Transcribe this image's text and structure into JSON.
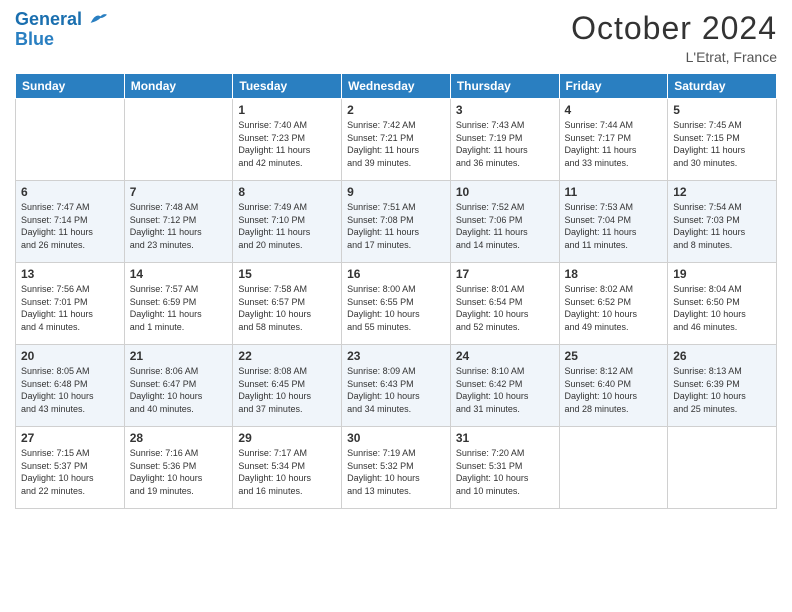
{
  "header": {
    "logo_line1": "General",
    "logo_line2": "Blue",
    "month": "October 2024",
    "location": "L'Etrat, France"
  },
  "weekdays": [
    "Sunday",
    "Monday",
    "Tuesday",
    "Wednesday",
    "Thursday",
    "Friday",
    "Saturday"
  ],
  "weeks": [
    [
      {
        "day": "",
        "info": ""
      },
      {
        "day": "",
        "info": ""
      },
      {
        "day": "1",
        "info": "Sunrise: 7:40 AM\nSunset: 7:23 PM\nDaylight: 11 hours\nand 42 minutes."
      },
      {
        "day": "2",
        "info": "Sunrise: 7:42 AM\nSunset: 7:21 PM\nDaylight: 11 hours\nand 39 minutes."
      },
      {
        "day": "3",
        "info": "Sunrise: 7:43 AM\nSunset: 7:19 PM\nDaylight: 11 hours\nand 36 minutes."
      },
      {
        "day": "4",
        "info": "Sunrise: 7:44 AM\nSunset: 7:17 PM\nDaylight: 11 hours\nand 33 minutes."
      },
      {
        "day": "5",
        "info": "Sunrise: 7:45 AM\nSunset: 7:15 PM\nDaylight: 11 hours\nand 30 minutes."
      }
    ],
    [
      {
        "day": "6",
        "info": "Sunrise: 7:47 AM\nSunset: 7:14 PM\nDaylight: 11 hours\nand 26 minutes."
      },
      {
        "day": "7",
        "info": "Sunrise: 7:48 AM\nSunset: 7:12 PM\nDaylight: 11 hours\nand 23 minutes."
      },
      {
        "day": "8",
        "info": "Sunrise: 7:49 AM\nSunset: 7:10 PM\nDaylight: 11 hours\nand 20 minutes."
      },
      {
        "day": "9",
        "info": "Sunrise: 7:51 AM\nSunset: 7:08 PM\nDaylight: 11 hours\nand 17 minutes."
      },
      {
        "day": "10",
        "info": "Sunrise: 7:52 AM\nSunset: 7:06 PM\nDaylight: 11 hours\nand 14 minutes."
      },
      {
        "day": "11",
        "info": "Sunrise: 7:53 AM\nSunset: 7:04 PM\nDaylight: 11 hours\nand 11 minutes."
      },
      {
        "day": "12",
        "info": "Sunrise: 7:54 AM\nSunset: 7:03 PM\nDaylight: 11 hours\nand 8 minutes."
      }
    ],
    [
      {
        "day": "13",
        "info": "Sunrise: 7:56 AM\nSunset: 7:01 PM\nDaylight: 11 hours\nand 4 minutes."
      },
      {
        "day": "14",
        "info": "Sunrise: 7:57 AM\nSunset: 6:59 PM\nDaylight: 11 hours\nand 1 minute."
      },
      {
        "day": "15",
        "info": "Sunrise: 7:58 AM\nSunset: 6:57 PM\nDaylight: 10 hours\nand 58 minutes."
      },
      {
        "day": "16",
        "info": "Sunrise: 8:00 AM\nSunset: 6:55 PM\nDaylight: 10 hours\nand 55 minutes."
      },
      {
        "day": "17",
        "info": "Sunrise: 8:01 AM\nSunset: 6:54 PM\nDaylight: 10 hours\nand 52 minutes."
      },
      {
        "day": "18",
        "info": "Sunrise: 8:02 AM\nSunset: 6:52 PM\nDaylight: 10 hours\nand 49 minutes."
      },
      {
        "day": "19",
        "info": "Sunrise: 8:04 AM\nSunset: 6:50 PM\nDaylight: 10 hours\nand 46 minutes."
      }
    ],
    [
      {
        "day": "20",
        "info": "Sunrise: 8:05 AM\nSunset: 6:48 PM\nDaylight: 10 hours\nand 43 minutes."
      },
      {
        "day": "21",
        "info": "Sunrise: 8:06 AM\nSunset: 6:47 PM\nDaylight: 10 hours\nand 40 minutes."
      },
      {
        "day": "22",
        "info": "Sunrise: 8:08 AM\nSunset: 6:45 PM\nDaylight: 10 hours\nand 37 minutes."
      },
      {
        "day": "23",
        "info": "Sunrise: 8:09 AM\nSunset: 6:43 PM\nDaylight: 10 hours\nand 34 minutes."
      },
      {
        "day": "24",
        "info": "Sunrise: 8:10 AM\nSunset: 6:42 PM\nDaylight: 10 hours\nand 31 minutes."
      },
      {
        "day": "25",
        "info": "Sunrise: 8:12 AM\nSunset: 6:40 PM\nDaylight: 10 hours\nand 28 minutes."
      },
      {
        "day": "26",
        "info": "Sunrise: 8:13 AM\nSunset: 6:39 PM\nDaylight: 10 hours\nand 25 minutes."
      }
    ],
    [
      {
        "day": "27",
        "info": "Sunrise: 7:15 AM\nSunset: 5:37 PM\nDaylight: 10 hours\nand 22 minutes."
      },
      {
        "day": "28",
        "info": "Sunrise: 7:16 AM\nSunset: 5:36 PM\nDaylight: 10 hours\nand 19 minutes."
      },
      {
        "day": "29",
        "info": "Sunrise: 7:17 AM\nSunset: 5:34 PM\nDaylight: 10 hours\nand 16 minutes."
      },
      {
        "day": "30",
        "info": "Sunrise: 7:19 AM\nSunset: 5:32 PM\nDaylight: 10 hours\nand 13 minutes."
      },
      {
        "day": "31",
        "info": "Sunrise: 7:20 AM\nSunset: 5:31 PM\nDaylight: 10 hours\nand 10 minutes."
      },
      {
        "day": "",
        "info": ""
      },
      {
        "day": "",
        "info": ""
      }
    ]
  ]
}
